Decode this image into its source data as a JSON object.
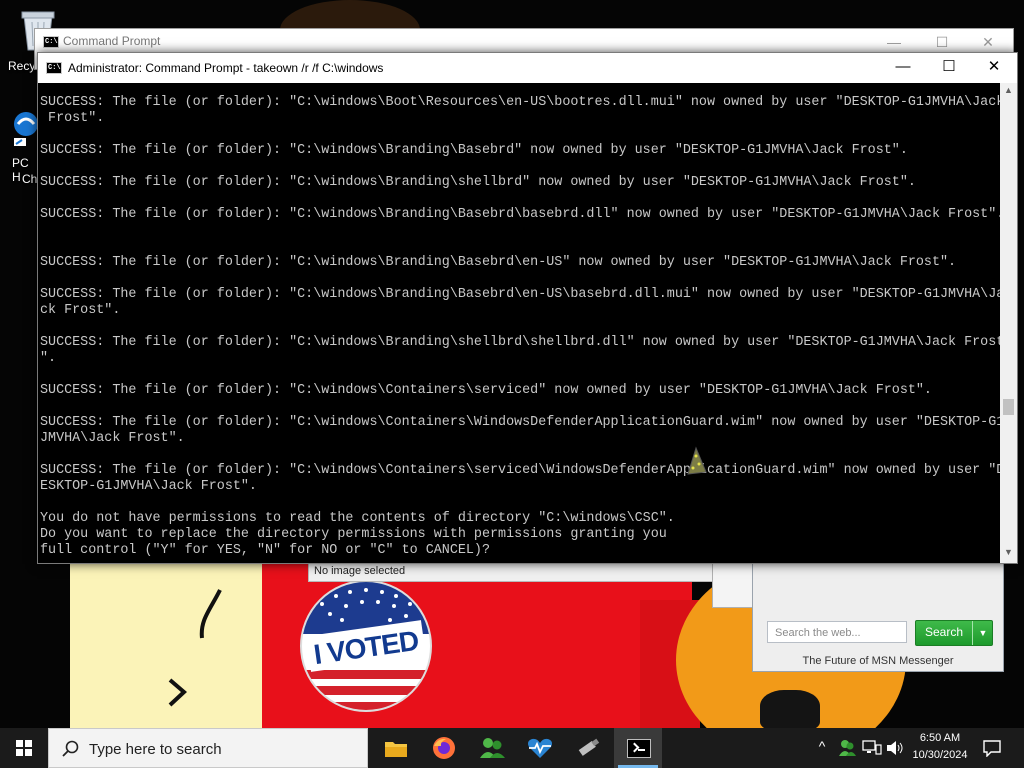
{
  "desktop": {
    "icons": [
      {
        "label": "Recyc",
        "icon": "recycle-bin-icon"
      },
      {
        "label": "PC H",
        "label2": "Ch",
        "icon": "pc-health-icon"
      }
    ]
  },
  "wallpaper": {
    "sticker_text": "I VOTED",
    "colors": {
      "yellow": "#fbf3b8",
      "red": "#e8101a",
      "pumpkin": "#f29a18"
    }
  },
  "image_viewer": {
    "status": "No image selected"
  },
  "msn": {
    "search_placeholder": "Search the web...",
    "search_button": "Search",
    "footer": "The Future of MSN Messenger"
  },
  "back_window": {
    "title": "Command Prompt",
    "icon_text": "C:\\"
  },
  "window": {
    "title": "Administrator: Command Prompt - takeown  /r /f C:\\windows",
    "icon_text": "C:\\",
    "controls": {
      "minimize": "—",
      "maximize": "☐",
      "close": "✕"
    }
  },
  "console": {
    "lines": [
      "SUCCESS: The file (or folder): \"C:\\windows\\Boot\\Resources\\en-US\\bootres.dll.mui\" now owned by user \"DESKTOP-G1JMVHA\\Jack",
      " Frost\".",
      "",
      "SUCCESS: The file (or folder): \"C:\\windows\\Branding\\Basebrd\" now owned by user \"DESKTOP-G1JMVHA\\Jack Frost\".",
      "",
      "SUCCESS: The file (or folder): \"C:\\windows\\Branding\\shellbrd\" now owned by user \"DESKTOP-G1JMVHA\\Jack Frost\".",
      "",
      "SUCCESS: The file (or folder): \"C:\\windows\\Branding\\Basebrd\\basebrd.dll\" now owned by user \"DESKTOP-G1JMVHA\\Jack Frost\".",
      "",
      "",
      "SUCCESS: The file (or folder): \"C:\\windows\\Branding\\Basebrd\\en-US\" now owned by user \"DESKTOP-G1JMVHA\\Jack Frost\".",
      "",
      "SUCCESS: The file (or folder): \"C:\\windows\\Branding\\Basebrd\\en-US\\basebrd.dll.mui\" now owned by user \"DESKTOP-G1JMVHA\\Ja",
      "ck Frost\".",
      "",
      "SUCCESS: The file (or folder): \"C:\\windows\\Branding\\shellbrd\\shellbrd.dll\" now owned by user \"DESKTOP-G1JMVHA\\Jack Frost",
      "\".",
      "",
      "SUCCESS: The file (or folder): \"C:\\windows\\Containers\\serviced\" now owned by user \"DESKTOP-G1JMVHA\\Jack Frost\".",
      "",
      "SUCCESS: The file (or folder): \"C:\\windows\\Containers\\WindowsDefenderApplicationGuard.wim\" now owned by user \"DESKTOP-G1",
      "JMVHA\\Jack Frost\".",
      "",
      "SUCCESS: The file (or folder): \"C:\\windows\\Containers\\serviced\\WindowsDefenderApplicationGuard.wim\" now owned by user \"D",
      "ESKTOP-G1JMVHA\\Jack Frost\".",
      "",
      "You do not have permissions to read the contents of directory \"C:\\windows\\CSC\".",
      "Do you want to replace the directory permissions with permissions granting you",
      "full control (\"Y\" for YES, \"N\" for NO or \"C\" to CANCEL)?"
    ]
  },
  "taskbar": {
    "search_placeholder": "Type here to search",
    "apps": [
      {
        "name": "file-explorer",
        "icon": "folder-icon"
      },
      {
        "name": "firefox",
        "icon": "firefox-icon"
      },
      {
        "name": "messenger",
        "icon": "messenger-icon"
      },
      {
        "name": "health-monitor",
        "icon": "heartbeat-icon"
      },
      {
        "name": "usb-tool",
        "icon": "usb-drive-icon"
      },
      {
        "name": "command-prompt",
        "icon": "terminal-icon",
        "active": true
      }
    ],
    "clock_time": "6:50 AM",
    "clock_date": "10/30/2024"
  }
}
